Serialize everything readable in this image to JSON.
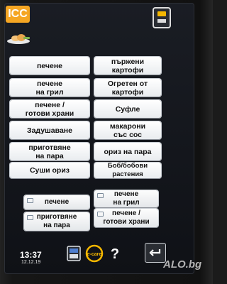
{
  "brand": {
    "logo_text": "ICC",
    "accent": "#f5a623"
  },
  "top": {
    "device_icon": "oven-device-icon",
    "dish_icon": "dish-icon"
  },
  "grid": {
    "left": [
      {
        "line1": "печене",
        "line2": ""
      },
      {
        "line1": "печене",
        "line2": "на грил"
      },
      {
        "line1": "печене /",
        "line2": "готови храни"
      },
      {
        "line1": "Задушаване",
        "line2": ""
      },
      {
        "line1": "приготвяне",
        "line2": "на пара"
      },
      {
        "line1": "Суши ориз",
        "line2": ""
      }
    ],
    "right": [
      {
        "line1": "пържени",
        "line2": "картофи"
      },
      {
        "line1": "Огретен от",
        "line2": "картофи"
      },
      {
        "line1": "Суфле",
        "line2": ""
      },
      {
        "line1": "макарони",
        "line2": "със сос"
      },
      {
        "line1": "ориз на пара",
        "line2": ""
      },
      {
        "line1": "Боб/бобови растения",
        "line2": ""
      }
    ]
  },
  "favorites": [
    {
      "line1": "печене",
      "line2": ""
    },
    {
      "line1": "печене",
      "line2": "на грил"
    },
    {
      "line1": "приготвяне",
      "line2": "на пара"
    },
    {
      "line1": "печене /",
      "line2": "готови храни"
    }
  ],
  "status": {
    "time": "13:37",
    "date": "12.12.19"
  },
  "bottom_icons": [
    "cabinet-icon",
    "ecare-icon",
    "help-icon",
    "back-icon"
  ],
  "ecare_label": "e-care",
  "help_glyph": "?",
  "watermark": "ALO.bg"
}
